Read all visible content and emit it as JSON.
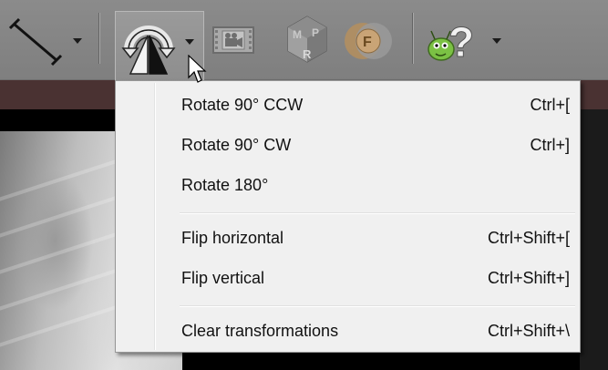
{
  "toolbar": {
    "buttons": [
      {
        "name": "measure-line-tool",
        "icon": "measure-line-icon"
      },
      {
        "name": "image-transform-tool",
        "icon": "rotate-flip-icon"
      },
      {
        "name": "cine-tool",
        "icon": "film-camera-icon"
      },
      {
        "name": "mpr-tool",
        "icon": "mpr-icon"
      },
      {
        "name": "fusion-tool",
        "icon": "fusion-icon"
      },
      {
        "name": "help-tool",
        "icon": "bug-help-icon"
      }
    ]
  },
  "context_menu": {
    "groups": [
      [
        {
          "label": "Rotate 90° CCW",
          "shortcut": "Ctrl+["
        },
        {
          "label": "Rotate 90° CW",
          "shortcut": "Ctrl+]"
        },
        {
          "label": "Rotate 180°",
          "shortcut": ""
        }
      ],
      [
        {
          "label": "Flip horizontal",
          "shortcut": "Ctrl+Shift+["
        },
        {
          "label": "Flip vertical",
          "shortcut": "Ctrl+Shift+]"
        }
      ],
      [
        {
          "label": "Clear transformations",
          "shortcut": "Ctrl+Shift+\\"
        }
      ]
    ]
  },
  "icon_letters": {
    "mpr_top_left": "M",
    "mpr_top_right": "P",
    "mpr_bottom": "R",
    "fusion": "F",
    "help": "?"
  },
  "colors": {
    "toolbar_bg": "#868686",
    "menu_bg": "#f0f0f0",
    "band": "#4a3232",
    "help_bug_green": "#7bc144"
  }
}
